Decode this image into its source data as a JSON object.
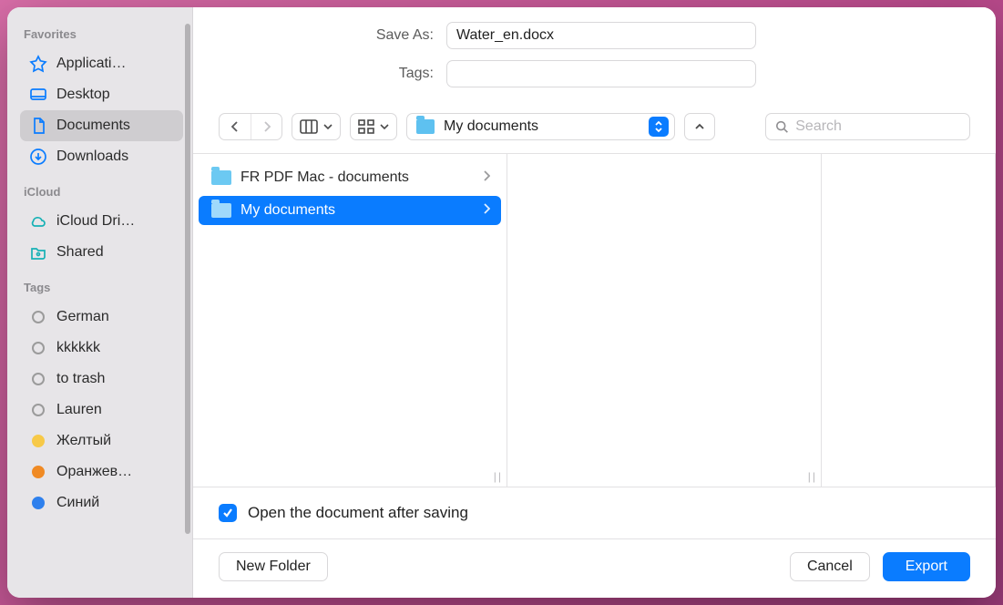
{
  "sidebar": {
    "sections": [
      {
        "title": "Favorites",
        "items": [
          {
            "icon": "apps",
            "label": "Applicati…",
            "selected": false
          },
          {
            "icon": "desktop",
            "label": "Desktop",
            "selected": false
          },
          {
            "icon": "document",
            "label": "Documents",
            "selected": true
          },
          {
            "icon": "download",
            "label": "Downloads",
            "selected": false
          }
        ]
      },
      {
        "title": "iCloud",
        "items": [
          {
            "icon": "cloud",
            "label": "iCloud Dri…",
            "selected": false
          },
          {
            "icon": "shared",
            "label": "Shared",
            "selected": false
          }
        ]
      },
      {
        "title": "Tags",
        "items": [
          {
            "icon": "tag-empty",
            "label": "German",
            "selected": false
          },
          {
            "icon": "tag-empty",
            "label": "kkkkkk",
            "selected": false
          },
          {
            "icon": "tag-empty",
            "label": "to trash",
            "selected": false
          },
          {
            "icon": "tag-empty",
            "label": "Lauren",
            "selected": false
          },
          {
            "icon": "tag-yellow",
            "label": "Желтый",
            "selected": false
          },
          {
            "icon": "tag-orange",
            "label": "Оранжев…",
            "selected": false
          },
          {
            "icon": "tag-blue",
            "label": "Синий",
            "selected": false
          }
        ]
      }
    ]
  },
  "form": {
    "save_as_label": "Save As:",
    "save_as_value": "Water_en.docx",
    "tags_label": "Tags:",
    "tags_value": ""
  },
  "toolbar": {
    "location_label": "My documents",
    "search_placeholder": "Search"
  },
  "browser": {
    "col1": [
      {
        "label": "FR PDF Mac - documents",
        "selected": false
      },
      {
        "label": "My documents",
        "selected": true
      }
    ]
  },
  "options": {
    "open_after_save_label": "Open the document after saving",
    "open_after_save_checked": true
  },
  "footer": {
    "new_folder_label": "New Folder",
    "cancel_label": "Cancel",
    "export_label": "Export"
  }
}
